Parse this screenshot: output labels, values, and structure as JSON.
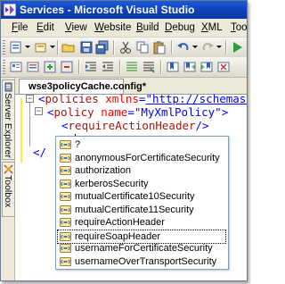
{
  "window": {
    "title": "Services - Microsoft Visual Studio"
  },
  "menu": [
    {
      "key": "F",
      "rest": "ile"
    },
    {
      "key": "E",
      "rest": "dit"
    },
    {
      "key": "V",
      "rest": "iew"
    },
    {
      "key": "W",
      "rest": "ebsite"
    },
    {
      "key": "B",
      "rest": "uild"
    },
    {
      "key": "D",
      "rest": "ebug"
    },
    {
      "key": "X",
      "rest": "ML"
    },
    {
      "key": "T",
      "rest": "ools"
    }
  ],
  "side_tabs": {
    "server_explorer": "Server Explorer",
    "toolbox": "Toolbox"
  },
  "document_tab": {
    "label": "wse3policyCache.config*"
  },
  "code": {
    "line1_open": "<",
    "line1_tag": "policies",
    "line1_attr": "xmlns",
    "line1_eq": "=",
    "line1_val": "\"http://schemas.m",
    "line2_open": "<",
    "line2_tag": "policy",
    "line2_attr": "name",
    "line2_eq": "=",
    "line2_val": "\"MyXmlPolicy\"",
    "line2_close": ">",
    "line3_open": "<",
    "line3_tag": "requireActionHeader",
    "line3_close": "/>",
    "line4_typed": "<r",
    "line5_fragment": "</"
  },
  "intellisense": {
    "items": [
      "?",
      "anonymousForCertificateSecurity",
      "authorization",
      "kerberosSecurity",
      "mutualCertificate10Security",
      "mutualCertificate11Security",
      "requireActionHeader",
      "requireSoapHeader",
      "usernameForCertificateSecurity",
      "usernameOverTransportSecurity"
    ],
    "selected": "requireSoapHeader"
  },
  "icons": {
    "app": "visual-studio-icon",
    "toolbar1": [
      "new-project-icon",
      "add-item-icon",
      "open-icon",
      "save-icon",
      "save-all-icon",
      "cut-icon",
      "copy-icon",
      "paste-icon",
      "undo-icon",
      "redo-icon"
    ],
    "toolbar2": [
      "toolbar-icon-1",
      "toolbar-icon-2",
      "toolbar-icon-3",
      "toolbar-icon-4",
      "indent-icon",
      "outdent-icon",
      "comment-icon",
      "uncomment-icon",
      "bookmark-icon",
      "bookmark-next-icon",
      "bookmark-prev-icon"
    ],
    "list_item": "xml-element-icon"
  },
  "colors": {
    "titlebar": "#1141b7",
    "chrome": "#ece9d8",
    "xml_delimiter": "#0000ff",
    "xml_tag": "#a31515",
    "xml_attribute": "#ff0000"
  }
}
